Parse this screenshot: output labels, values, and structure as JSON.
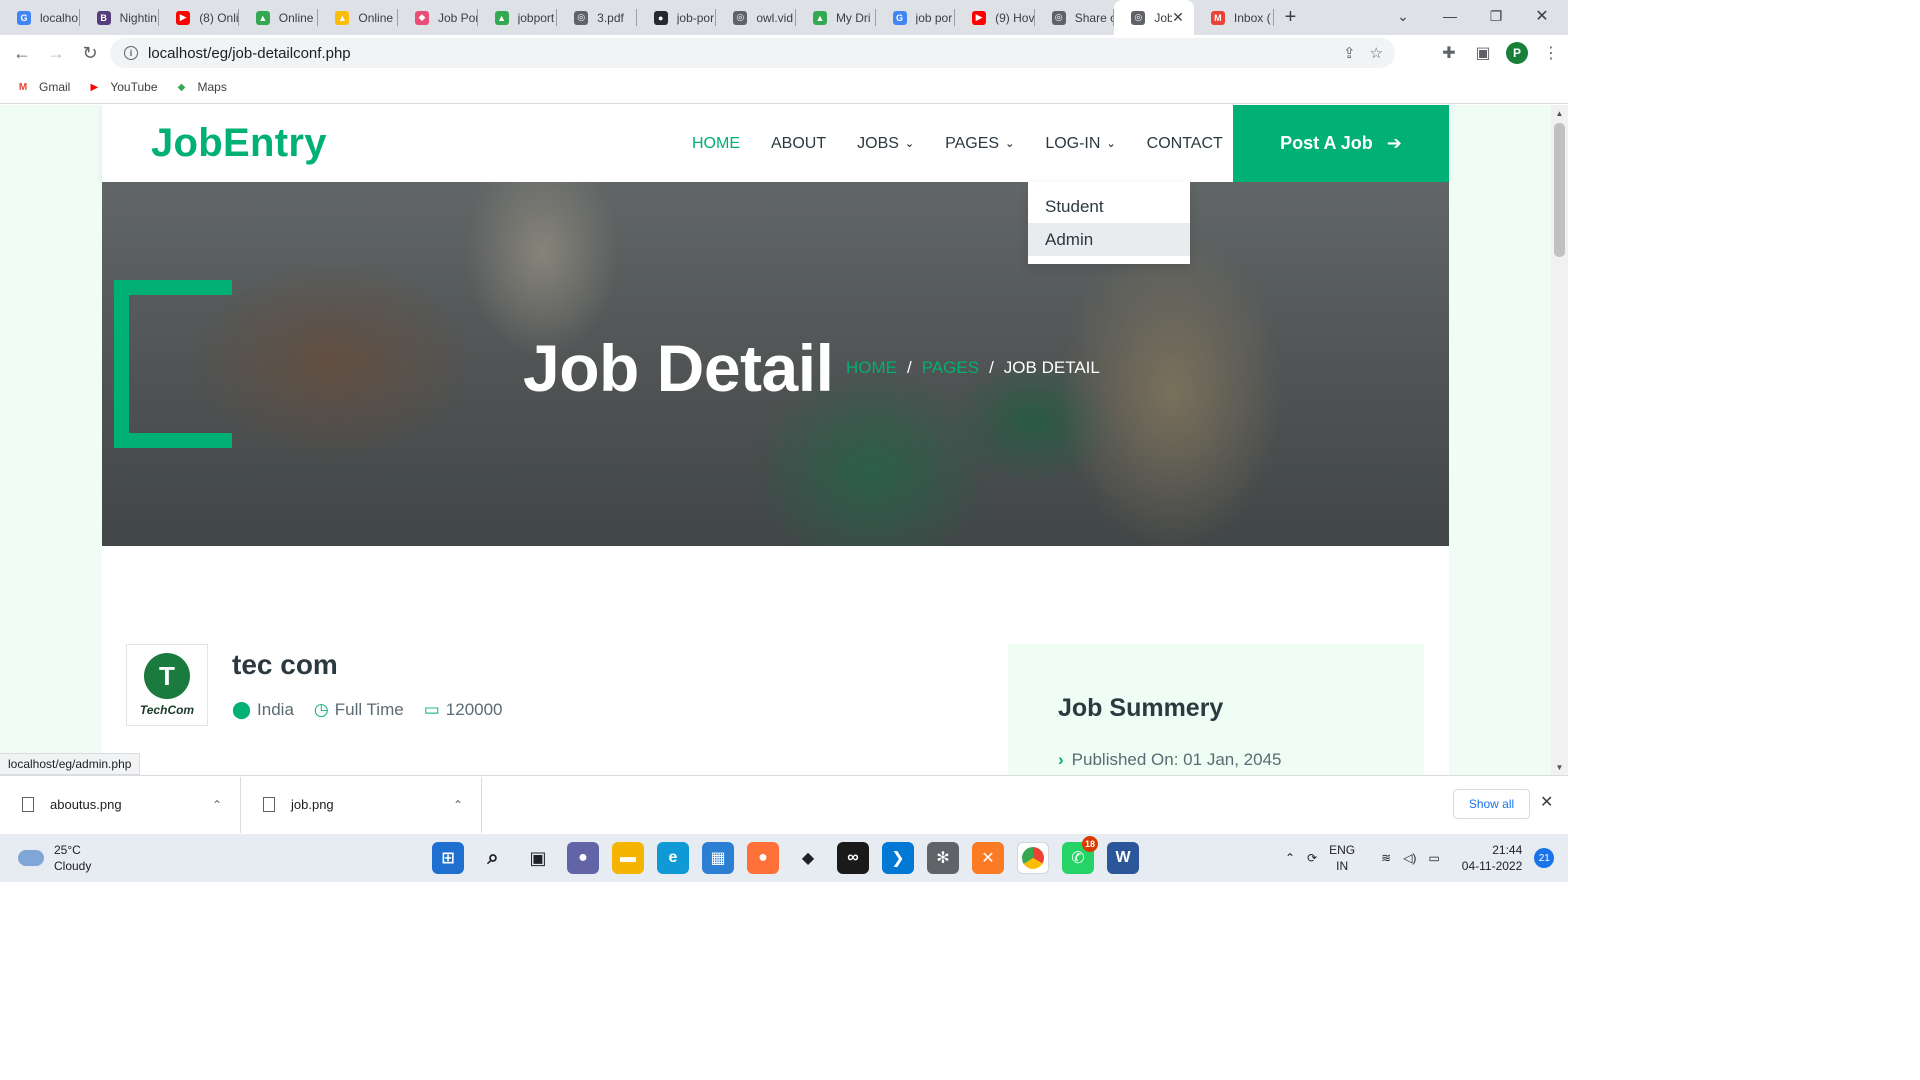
{
  "browser": {
    "tabs": [
      {
        "title": "localho",
        "icon": "google-icon",
        "color": "#4285f4",
        "glyph": "G"
      },
      {
        "title": "Nightin",
        "icon": "bootstrap-icon",
        "color": "#563d7c",
        "glyph": "B"
      },
      {
        "title": "(8) Onli",
        "icon": "youtube-icon",
        "color": "#ff0000",
        "glyph": "▶"
      },
      {
        "title": "Online",
        "icon": "drive-icon",
        "color": "#34a853",
        "glyph": "▲"
      },
      {
        "title": "Online",
        "icon": "drive-icon",
        "color": "#fbbc04",
        "glyph": "▲"
      },
      {
        "title": "Job Por",
        "icon": "cube-icon",
        "color": "#e94e77",
        "glyph": "◆"
      },
      {
        "title": "jobport",
        "icon": "drive-icon",
        "color": "#34a853",
        "glyph": "▲"
      },
      {
        "title": "3.pdf",
        "icon": "globe-icon",
        "color": "#5f6368",
        "glyph": "◎"
      },
      {
        "title": "job-por",
        "icon": "github-icon",
        "color": "#24292e",
        "glyph": "●"
      },
      {
        "title": "owl.vid",
        "icon": "globe-icon",
        "color": "#5f6368",
        "glyph": "◎"
      },
      {
        "title": "My Dri",
        "icon": "drive-icon",
        "color": "#34a853",
        "glyph": "▲"
      },
      {
        "title": "job por",
        "icon": "google-icon",
        "color": "#4285f4",
        "glyph": "G"
      },
      {
        "title": "(9) Hov",
        "icon": "youtube-icon",
        "color": "#ff0000",
        "glyph": "▶"
      },
      {
        "title": "Share c",
        "icon": "globe-icon",
        "color": "#5f6368",
        "glyph": "◎"
      },
      {
        "title": "Job",
        "icon": "globe-icon",
        "color": "#5f6368",
        "glyph": "◎",
        "active": true
      },
      {
        "title": "Inbox (",
        "icon": "gmail-icon",
        "color": "#ea4335",
        "glyph": "M"
      }
    ],
    "url": "localhost/eg/job-detailconf.php",
    "profile_initial": "P",
    "bookmarks": [
      {
        "label": "Gmail",
        "icon": "gmail-icon",
        "color": "#ea4335",
        "glyph": "M"
      },
      {
        "label": "YouTube",
        "icon": "youtube-icon",
        "color": "#ff0000",
        "glyph": "▶"
      },
      {
        "label": "Maps",
        "icon": "maps-icon",
        "color": "#34a853",
        "glyph": "◆"
      }
    ],
    "status_url": "localhost/eg/admin.php"
  },
  "site": {
    "brand": "JobEntry",
    "nav": {
      "home": "HOME",
      "about": "ABOUT",
      "jobs": "JOBS",
      "pages": "PAGES",
      "login": "LOG-IN",
      "contact": "CONTACT"
    },
    "post_job": "Post A Job",
    "login_dropdown": [
      "Student",
      "Admin"
    ],
    "hero": {
      "title": "Job Detail",
      "crumb_home": "HOME",
      "crumb_pages": "PAGES",
      "crumb_current": "JOB DETAIL",
      "sep": "/"
    },
    "job": {
      "logo_text": "TechCom",
      "company": "tec com",
      "location": "India",
      "type": "Full Time",
      "salary": "120000"
    },
    "summary": {
      "title": "Job Summery",
      "published": "Published On: 01 Jan, 2045"
    },
    "accent": "#00b074"
  },
  "downloads": {
    "items": [
      "aboutus.png",
      "job.png"
    ],
    "show_all": "Show all"
  },
  "taskbar": {
    "temp": "25°C",
    "weather": "Cloudy",
    "lang1": "ENG",
    "lang2": "IN",
    "time": "21:44",
    "date": "04-11-2022",
    "notifications": "21",
    "whatsapp_badge": "18"
  }
}
